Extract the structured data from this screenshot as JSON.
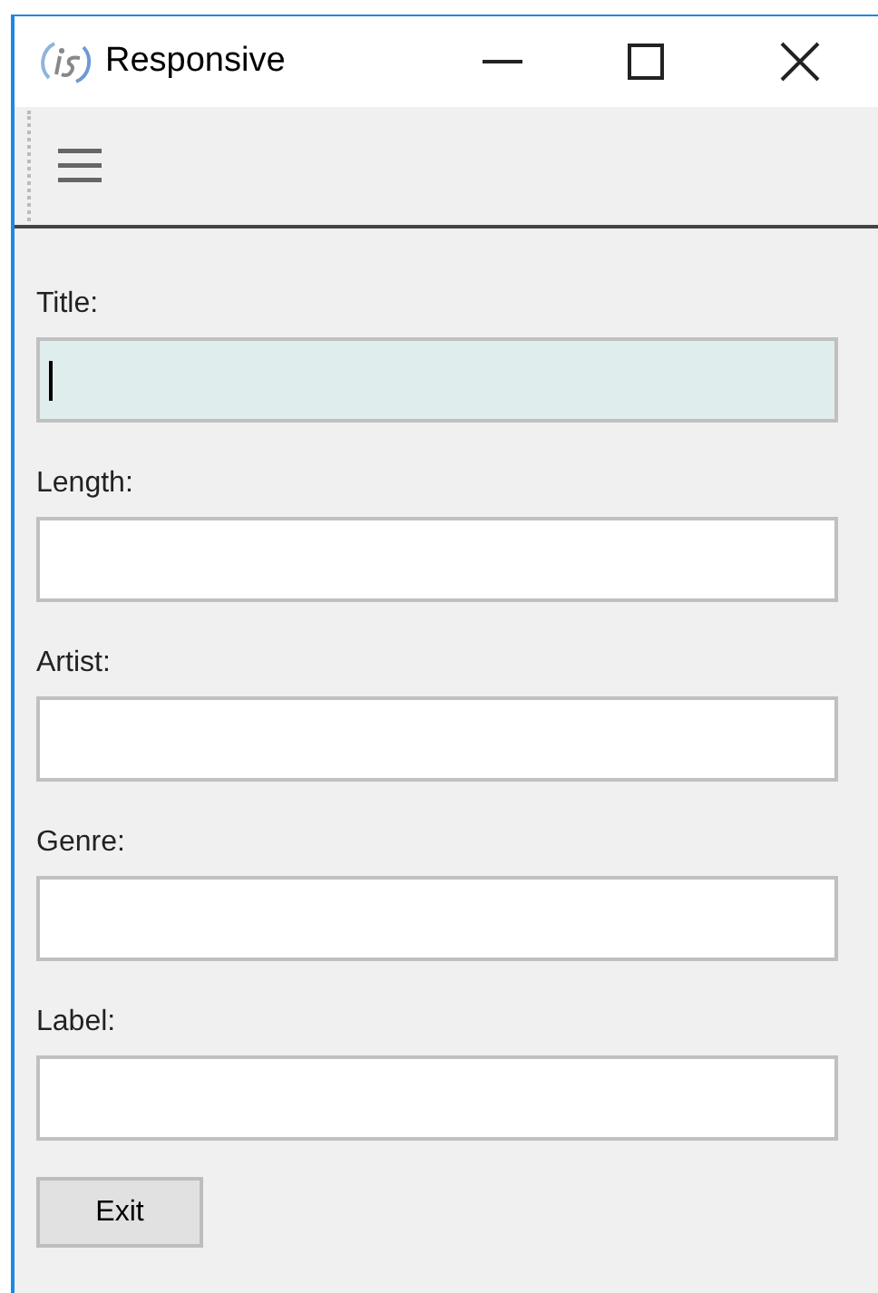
{
  "window": {
    "title": "Responsive"
  },
  "fields": [
    {
      "label": "Title:",
      "focused": true
    },
    {
      "label": "Length:",
      "focused": false
    },
    {
      "label": "Artist:",
      "focused": false
    },
    {
      "label": "Genre:",
      "focused": false
    },
    {
      "label": "Label:",
      "focused": false
    }
  ],
  "buttons": [
    "Exit"
  ]
}
